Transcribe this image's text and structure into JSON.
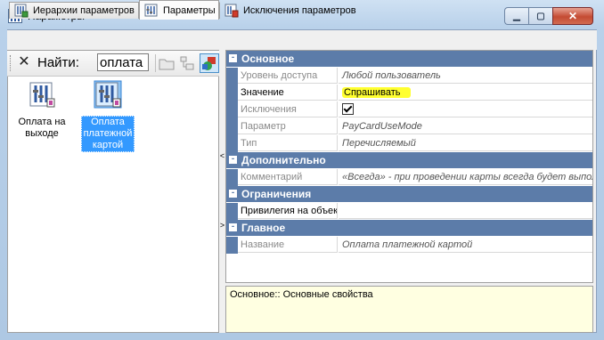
{
  "window": {
    "title": "Параметры"
  },
  "tabs": [
    {
      "label": "Иерархии параметров",
      "active": false
    },
    {
      "label": "Параметры",
      "active": true
    },
    {
      "label": "Исключения параметров",
      "active": false
    }
  ],
  "toolbar": {
    "find_label": "Найти:",
    "find_value": "оплата"
  },
  "items": [
    {
      "label": "Оплата на выходе",
      "selected": false
    },
    {
      "label": "Оплата платежной картой",
      "selected": true
    }
  ],
  "splitter": {
    "arrow_top": "<",
    "arrow_bottom": ">"
  },
  "grid": {
    "categories": [
      {
        "label": "Основное",
        "toggle": "-",
        "rows": [
          {
            "name": "Уровень доступа",
            "value": "Любой пользователь",
            "readonly": true
          },
          {
            "name": "Значение",
            "value": "Спрашивать",
            "readonly": false,
            "highlighted": true
          },
          {
            "name": "Исключения",
            "value": "",
            "readonly": true,
            "checkbox": true,
            "checked": true
          },
          {
            "name": "Параметр",
            "value": "PayCardUseMode",
            "readonly": true
          },
          {
            "name": "Тип",
            "value": "Перечисляемый",
            "readonly": true
          }
        ]
      },
      {
        "label": "Дополнительно",
        "toggle": "-",
        "rows": [
          {
            "name": "Комментарий",
            "value": "«Всегда» - при проведении карты всегда будет выпол",
            "readonly": true
          }
        ]
      },
      {
        "label": "Ограничения",
        "toggle": "-",
        "rows": [
          {
            "name": "Привилегия на объект",
            "value": "",
            "readonly": false
          }
        ]
      },
      {
        "label": "Главное",
        "toggle": "-",
        "rows": [
          {
            "name": "Название",
            "value": "Оплата платежной картой",
            "readonly": true
          }
        ]
      }
    ]
  },
  "description": "Основное:: Основные свойства",
  "colors": {
    "category_bg": "#5c7ca9",
    "highlight": "#ffff30",
    "selection": "#3399ff",
    "desc_bg": "#ffffe1"
  }
}
